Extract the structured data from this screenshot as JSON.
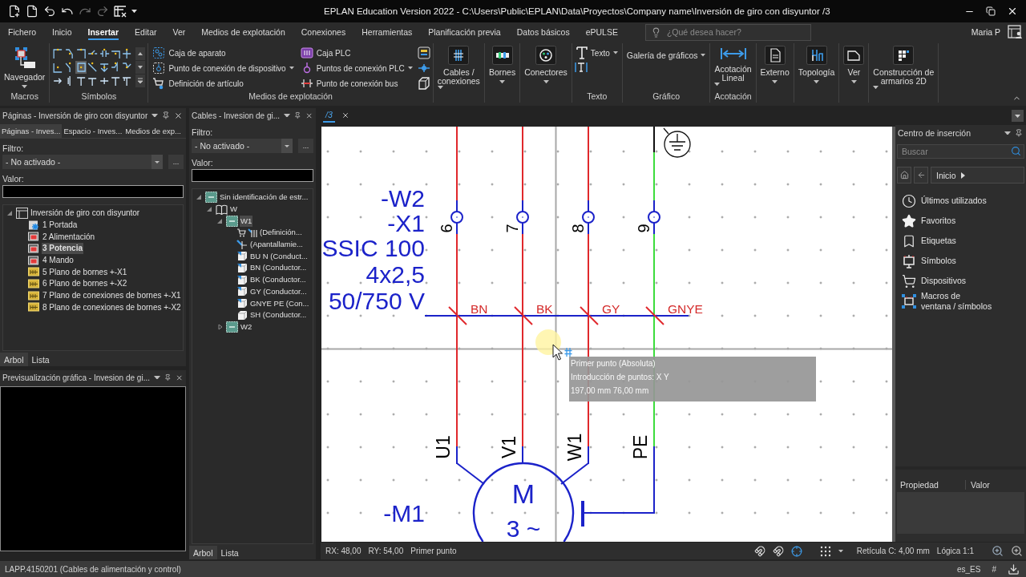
{
  "title_bar": {
    "title": "EPLAN Education Version 2022 - C:\\Users\\Public\\EPLAN\\Data\\Proyectos\\Company name\\Inversión de giro con disyuntor /3",
    "quick_access": [
      {
        "disabled": false
      },
      {
        "disabled": false
      },
      {
        "disabled": false
      },
      {
        "disabled": false
      },
      {
        "disabled": true
      },
      {
        "disabled": true
      },
      {
        "disabled": false
      }
    ]
  },
  "menu_tabs": [
    {
      "label": "Fichero",
      "selected": false
    },
    {
      "label": "Inicio",
      "selected": false
    },
    {
      "label": "Insertar",
      "selected": true
    },
    {
      "label": "Editar",
      "selected": false
    },
    {
      "label": "Ver",
      "selected": false
    },
    {
      "label": "Medios de explotación",
      "selected": false
    },
    {
      "label": "Conexiones",
      "selected": false
    },
    {
      "label": "Herramientas",
      "selected": false
    },
    {
      "label": "Planificación previa",
      "selected": false
    },
    {
      "label": "Datos básicos",
      "selected": false
    },
    {
      "label": "ePULSE",
      "selected": false
    }
  ],
  "search": {
    "placeholder": "¿Qué desea hacer?"
  },
  "user": "Maria P",
  "ribbon": [
    {
      "kind": "navigator",
      "label": "Macros",
      "buttons": [
        "Navegador"
      ]
    },
    {
      "kind": "gallery",
      "label": "Símbolos",
      "tiles": [
        {
          "selected": false
        },
        {
          "selected": false
        },
        {
          "selected": false
        },
        {
          "selected": false
        },
        {
          "selected": false
        },
        {
          "selected": false
        },
        {
          "selected": false
        },
        {
          "selected": false
        },
        {
          "selected": false
        },
        {
          "selected": true
        },
        {
          "selected": false
        },
        {
          "selected": false
        },
        {
          "selected": false
        },
        {
          "selected": false
        },
        {
          "selected": false
        },
        {
          "selected": false
        },
        {
          "selected": false
        },
        {
          "selected": false
        },
        {
          "selected": false
        },
        {
          "selected": false
        },
        {
          "selected": false
        }
      ]
    },
    {
      "kind": "devices",
      "label": "Medios de explotación",
      "buttons": [
        "Caja de aparato",
        "Punto de conexión de dispositivo",
        "Definición de artículo",
        "Caja PLC",
        "Puntos de conexión PLC",
        "Punto de conexión bus"
      ]
    },
    {
      "kind": "large",
      "buttons": [
        "Cables /\nconexiones"
      ]
    },
    {
      "kind": "large",
      "buttons": [
        "Bornes"
      ]
    },
    {
      "kind": "large",
      "buttons": [
        "Conectores"
      ]
    },
    {
      "kind": "text",
      "label": "Texto",
      "buttons": [
        "Texto"
      ]
    },
    {
      "kind": "graphic",
      "label": "Gráfico",
      "buttons": [
        "Galería de gráficos"
      ]
    },
    {
      "kind": "large",
      "label": "Acotación",
      "buttons": [
        "Acotación\nLineal"
      ]
    },
    {
      "kind": "large",
      "buttons": [
        "Externo"
      ]
    },
    {
      "kind": "large",
      "buttons": [
        "Topología"
      ]
    },
    {
      "kind": "large",
      "buttons": [
        "Ver"
      ]
    },
    {
      "kind": "large",
      "buttons": [
        "Construcción de\narmarios 2D"
      ]
    }
  ],
  "pages_panel": {
    "title": "Páginas - Inversión de giro con disyuntor",
    "tabs": [
      {
        "label": "Páginas - Inves...",
        "selected": true
      },
      {
        "label": "Espacio - Inves...",
        "selected": false
      },
      {
        "label": "Medios de exp...",
        "selected": false
      }
    ],
    "filter_label": "Filtro:",
    "filter": "- No activado -",
    "more": "...",
    "value_label": "Valor:",
    "tree": [
      {
        "label": "Inversión de giro con disyuntor",
        "kind": "project",
        "selected": false,
        "expanded": true,
        "children": [
          {
            "label": "1 Portada",
            "kind": "cover",
            "selected": false
          },
          {
            "label": "2 Alimentación",
            "kind": "schematic",
            "selected": false
          },
          {
            "label": "3 Potencia",
            "kind": "schematic",
            "selected": true
          },
          {
            "label": "4 Mando",
            "kind": "schematic",
            "selected": false
          },
          {
            "label": "5 Plano de bornes +-X1",
            "kind": "terminal",
            "selected": false
          },
          {
            "label": "6 Plano de bornes +-X2",
            "kind": "terminal",
            "selected": false
          },
          {
            "label": "7 Plano de conexiones de bornes +-X1",
            "kind": "terminal",
            "selected": false
          },
          {
            "label": "8 Plano de conexiones de bornes +-X2",
            "kind": "terminal",
            "selected": false
          }
        ]
      }
    ],
    "view_tabs": [
      {
        "label": "Arbol",
        "selected": true
      },
      {
        "label": "Lista",
        "selected": false
      }
    ]
  },
  "preview_panel": {
    "title": "Previsualización gráfica - Invesion de gi..."
  },
  "cables_panel": {
    "title": "Cables - Invesion de gi...",
    "filter_label": "Filtro:",
    "filter": "- No activado -",
    "more": "...",
    "value_label": "Valor:",
    "tree": [
      {
        "label": "Sin identificación de estr...",
        "kind": "structure",
        "selected": false,
        "expanded": true,
        "children": [
          {
            "label": "W",
            "kind": "book",
            "selected": false,
            "expanded": true,
            "children": [
              {
                "label": "W1",
                "kind": "cable",
                "selected": true,
                "expanded": true,
                "children": [
                  {
                    "label": "(Definición...",
                    "kind": "article",
                    "selected": false
                  },
                  {
                    "label": "(Apantallamie...",
                    "kind": "shield",
                    "selected": false
                  },
                  {
                    "label": "BU N (Conduct...",
                    "kind": "conductor",
                    "selected": false
                  },
                  {
                    "label": "BN (Conductor...",
                    "kind": "conductor",
                    "selected": false
                  },
                  {
                    "label": "BK (Conductor...",
                    "kind": "conductor",
                    "selected": false
                  },
                  {
                    "label": "GY (Conductor...",
                    "kind": "conductor",
                    "selected": false
                  },
                  {
                    "label": "GNYE PE (Con...",
                    "kind": "conductor",
                    "selected": false
                  },
                  {
                    "label": "SH (Conductor...",
                    "kind": "plain_conductor",
                    "selected": false
                  }
                ]
              },
              {
                "label": "W2",
                "kind": "cable",
                "selected": false,
                "expanded": false
              }
            ]
          }
        ]
      }
    ],
    "view_tabs": [
      {
        "label": "Arbol",
        "selected": true
      },
      {
        "label": "Lista",
        "selected": false
      }
    ]
  },
  "document_tabs": [
    {
      "label": "/3",
      "selected": true
    }
  ],
  "schematic": {
    "designations": [
      "-W2",
      "-X1",
      "SSIC 100",
      "4x2,5",
      "50/750 V"
    ],
    "wires": [
      {
        "kind": "phase",
        "terminal": "6",
        "conductor": "BN",
        "motor_terminal": "U1",
        "color": "#e0282c"
      },
      {
        "kind": "phase",
        "terminal": "7",
        "conductor": "BK",
        "motor_terminal": "V1",
        "color": "#e0282c"
      },
      {
        "kind": "phase",
        "terminal": "8",
        "conductor": "GY",
        "motor_terminal": "W1",
        "color": "#e0282c"
      },
      {
        "kind": "protective",
        "terminal": "9",
        "conductor": "GNYE",
        "motor_terminal": "PE",
        "color": "#3cdc3c"
      }
    ],
    "motor": {
      "tag": "-M1",
      "symbol": "M",
      "rating": "3 ~"
    }
  },
  "tooltip": {
    "lines": [
      "Primer punto (Absoluta)",
      "Introducción de puntos: X Y",
      "197,00 mm 76,00 mm"
    ]
  },
  "canvas_status": {
    "rx": "RX: 48,00",
    "ry": "RY: 54,00",
    "prompt": "Primer punto",
    "grid": "Retícula C: 4,00 mm",
    "logic": "Lógica 1:1"
  },
  "insert_center": {
    "title": "Centro de inserción",
    "search_placeholder": "Buscar",
    "breadcrumb": "Inicio",
    "items": [
      "Últimos utilizados",
      "Favoritos",
      "Etiquetas",
      "Símbolos",
      "Dispositivos",
      "Macros de\nventana / símbolos"
    ],
    "columns": [
      "Propiedad",
      "Valor"
    ]
  },
  "status_bar": {
    "message": "LAPP.4150201 (Cables de alimentación y control)",
    "language": "es_ES",
    "hash": "#"
  }
}
